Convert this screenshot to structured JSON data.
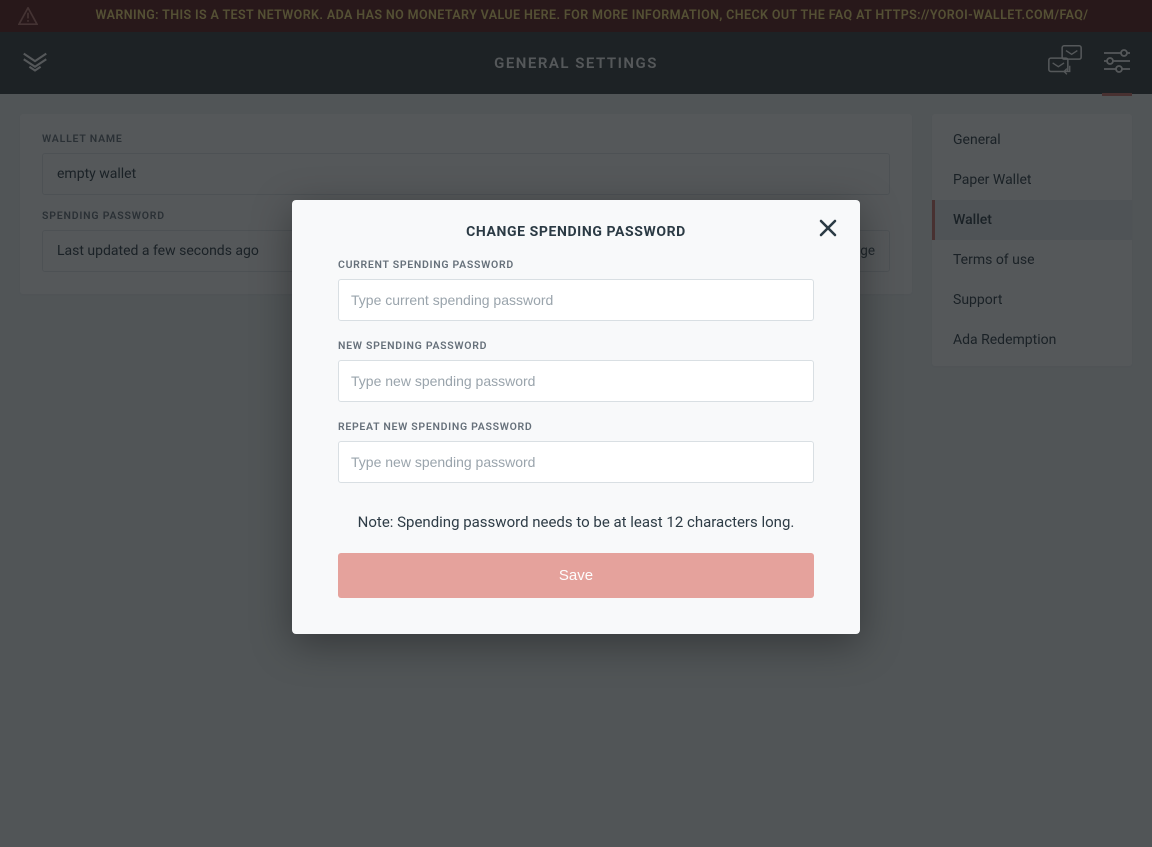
{
  "warning": {
    "text": "WARNING: THIS IS A TEST NETWORK. ADA HAS NO MONETARY VALUE HERE. FOR MORE INFORMATION, CHECK OUT THE FAQ AT HTTPS://YOROI-WALLET.COM/FAQ/"
  },
  "header": {
    "title": "GENERAL SETTINGS"
  },
  "main": {
    "wallet_name_label": "WALLET NAME",
    "wallet_name_value": "empty wallet",
    "spending_label": "SPENDING PASSWORD",
    "spending_status": "Last updated a few seconds ago",
    "change_link": "change"
  },
  "sidenav": {
    "items": [
      {
        "label": "General",
        "active": false
      },
      {
        "label": "Paper Wallet",
        "active": false
      },
      {
        "label": "Wallet",
        "active": true
      },
      {
        "label": "Terms of use",
        "active": false
      },
      {
        "label": "Support",
        "active": false
      },
      {
        "label": "Ada Redemption",
        "active": false
      }
    ]
  },
  "modal": {
    "title": "CHANGE SPENDING PASSWORD",
    "current_label": "CURRENT SPENDING PASSWORD",
    "current_placeholder": "Type current spending password",
    "new_label": "NEW SPENDING PASSWORD",
    "new_placeholder": "Type new spending password",
    "repeat_label": "REPEAT NEW SPENDING PASSWORD",
    "repeat_placeholder": "Type new spending password",
    "note": "Note: Spending password needs to be at least 12 characters long.",
    "save_label": "Save"
  }
}
